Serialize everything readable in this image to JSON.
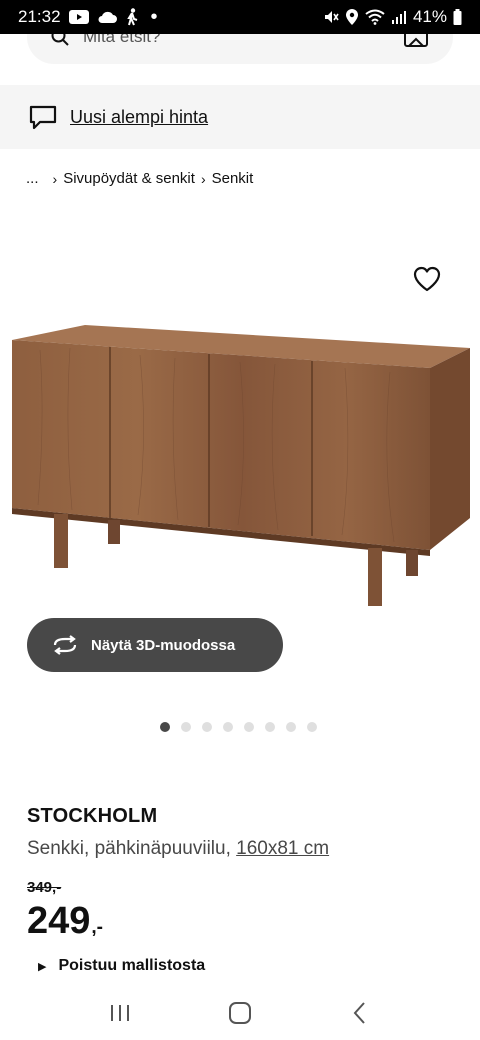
{
  "status_bar": {
    "time": "21:32",
    "battery": "41%",
    "icons": [
      "youtube-icon",
      "cloud-icon",
      "walk-icon",
      "dot-icon",
      "mute-icon",
      "location-icon",
      "wifi-icon",
      "signal-icon",
      "battery-icon"
    ]
  },
  "search": {
    "placeholder": "Mitä etsit?"
  },
  "notice": {
    "icon": "chat-bubble-icon",
    "text": "Uusi alempi hinta"
  },
  "breadcrumb": {
    "items": [
      "...",
      "Sivupöydät & senkit",
      "Senkit"
    ]
  },
  "gallery": {
    "button_3d": "Näytä 3D-muodossa",
    "dot_count": 8,
    "active_dot": 0
  },
  "product": {
    "name": "STOCKHOLM",
    "description": "Senkki, pähkinäpuuviilu,",
    "size": "160x81 cm",
    "old_price": "349,-",
    "price_int": "249",
    "price_dec": ",-",
    "discontinued": "Poistuu mallistosta"
  },
  "colors": {
    "button_dark": "#484848",
    "notice_bg": "#f5f5f5",
    "wood": "#8a5a3a"
  }
}
